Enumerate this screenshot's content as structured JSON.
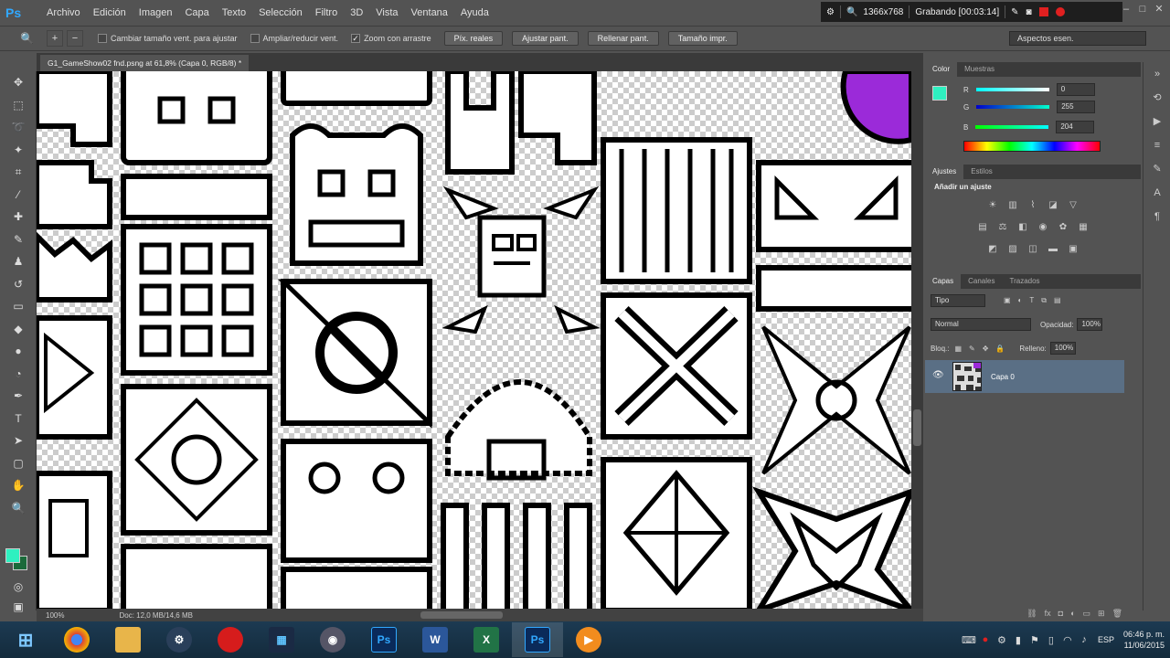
{
  "app": {
    "logo_text": "Ps"
  },
  "menu": [
    "Archivo",
    "Edición",
    "Imagen",
    "Capa",
    "Texto",
    "Selección",
    "Filtro",
    "3D",
    "Vista",
    "Ventana",
    "Ayuda"
  ],
  "recorder": {
    "resolution": "1366x768",
    "status": "Grabando [00:03:14]"
  },
  "options": {
    "check1_label": "Cambiar tamaño vent. para ajustar",
    "check2_label": "Ampliar/reducir vent.",
    "check3_label": "Zoom con arrastre",
    "btn1": "Píx. reales",
    "btn2": "Ajustar pant.",
    "btn3": "Rellenar pant.",
    "btn4": "Tamaño impr.",
    "workspace": "Aspectos esen."
  },
  "document": {
    "tab_title": "G1_GameShow02 fnd.psng at 61,8% (Capa 0, RGB/8) *",
    "zoom": "100%",
    "doc_info": "Doc: 12,0 MB/14,6 MB"
  },
  "color_panel": {
    "tabs": [
      "Color",
      "Muestras"
    ],
    "r_label": "R",
    "r_value": "0",
    "g_label": "G",
    "g_value": "255",
    "b_label": "B",
    "b_value": "204",
    "fg_color": "#2ef0c0"
  },
  "adjust_panel": {
    "tabs": [
      "Ajustes",
      "Estilos"
    ],
    "title": "Añadir un ajuste"
  },
  "layers_panel": {
    "tabs": [
      "Capas",
      "Canales",
      "Trazados"
    ],
    "filter_kind": "Tipo",
    "blend_mode": "Normal",
    "opacity_label": "Opacidad:",
    "opacity_value": "100%",
    "lock_label": "Bloq.:",
    "fill_label": "Relleno:",
    "fill_value": "100%",
    "layer_name": "Capa 0"
  },
  "taskbar": {
    "lang": "ESP",
    "time": "06:46 p. m.",
    "date": "11/06/2015",
    "apps": [
      "windows-start",
      "chrome",
      "file-explorer",
      "steam",
      "record-app",
      "video-editor",
      "media-app",
      "photoshop-1",
      "word",
      "excel",
      "photoshop-2",
      "media-player"
    ]
  },
  "colors": {
    "accent": "#31a8ff",
    "panel_bg": "#535353",
    "recording_red": "#e02020",
    "layer_selected": "#5a6f85"
  }
}
